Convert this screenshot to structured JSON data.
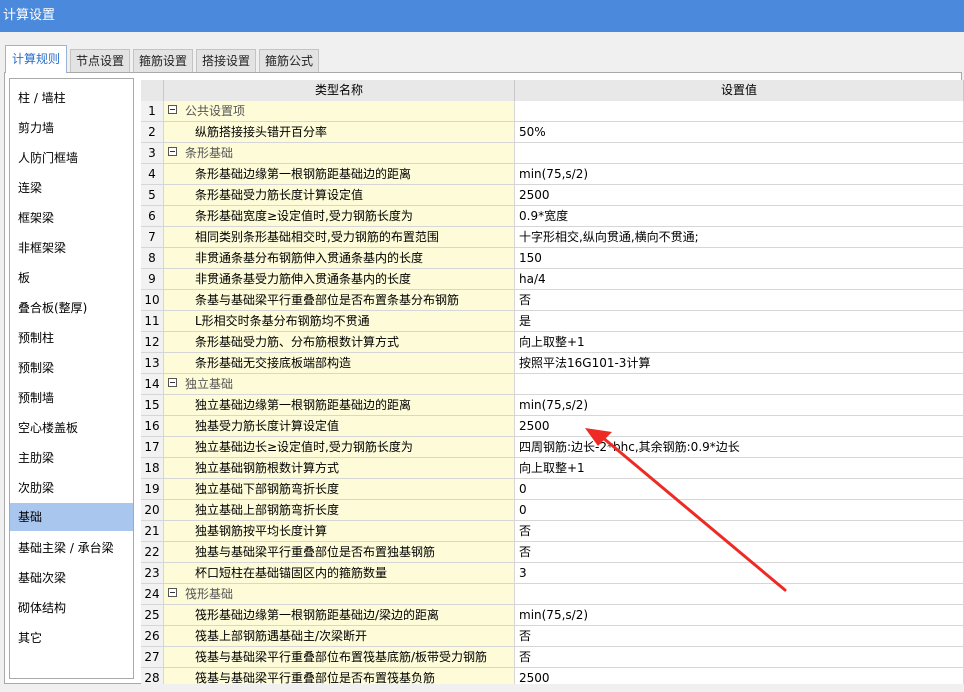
{
  "window": {
    "title": "计算设置"
  },
  "tabs": [
    {
      "label": "计算规则",
      "active": true
    },
    {
      "label": "节点设置",
      "active": false
    },
    {
      "label": "箍筋设置",
      "active": false
    },
    {
      "label": "搭接设置",
      "active": false
    },
    {
      "label": "箍筋公式",
      "active": false
    }
  ],
  "sidebar": {
    "items": [
      {
        "label": "柱 / 墙柱"
      },
      {
        "label": "剪力墙"
      },
      {
        "label": "人防门框墙"
      },
      {
        "label": "连梁"
      },
      {
        "label": "框架梁"
      },
      {
        "label": "非框架梁"
      },
      {
        "label": "板"
      },
      {
        "label": "叠合板(整厚)"
      },
      {
        "label": "预制柱"
      },
      {
        "label": "预制梁"
      },
      {
        "label": "预制墙"
      },
      {
        "label": "空心楼盖板"
      },
      {
        "label": "主肋梁"
      },
      {
        "label": "次肋梁"
      },
      {
        "label": "基础",
        "selected": true
      },
      {
        "label": "基础主梁 / 承台梁"
      },
      {
        "label": "基础次梁"
      },
      {
        "label": "砌体结构"
      },
      {
        "label": "其它"
      }
    ]
  },
  "grid": {
    "columns": {
      "name": "类型名称",
      "value": "设置值"
    },
    "rows": [
      {
        "num": "1",
        "name": "公共设置项",
        "value": "",
        "group": true
      },
      {
        "num": "2",
        "name": "纵筋搭接接头错开百分率",
        "value": "50%"
      },
      {
        "num": "3",
        "name": "条形基础",
        "value": "",
        "group": true
      },
      {
        "num": "4",
        "name": "条形基础边缘第一根钢筋距基础边的距离",
        "value": "min(75,s/2)"
      },
      {
        "num": "5",
        "name": "条形基础受力筋长度计算设定值",
        "value": "2500"
      },
      {
        "num": "6",
        "name": "条形基础宽度≥设定值时,受力钢筋长度为",
        "value": "0.9*宽度"
      },
      {
        "num": "7",
        "name": "相同类别条形基础相交时,受力钢筋的布置范围",
        "value": "十字形相交,纵向贯通,横向不贯通;"
      },
      {
        "num": "8",
        "name": "非贯通条基分布钢筋伸入贯通条基内的长度",
        "value": "150"
      },
      {
        "num": "9",
        "name": "非贯通条基受力筋伸入贯通条基内的长度",
        "value": "ha/4"
      },
      {
        "num": "10",
        "name": "条基与基础梁平行重叠部位是否布置条基分布钢筋",
        "value": "否"
      },
      {
        "num": "11",
        "name": "L形相交时条基分布钢筋均不贯通",
        "value": "是"
      },
      {
        "num": "12",
        "name": "条形基础受力筋、分布筋根数计算方式",
        "value": "向上取整+1"
      },
      {
        "num": "13",
        "name": "条形基础无交接底板端部构造",
        "value": "按照平法16G101-3计算"
      },
      {
        "num": "14",
        "name": "独立基础",
        "value": "",
        "group": true
      },
      {
        "num": "15",
        "name": "独立基础边缘第一根钢筋距基础边的距离",
        "value": "min(75,s/2)"
      },
      {
        "num": "16",
        "name": "独基受力筋长度计算设定值",
        "value": "2500"
      },
      {
        "num": "17",
        "name": "独立基础边长≥设定值时,受力钢筋长度为",
        "value": "四周钢筋:边长-2*bhc,其余钢筋:0.9*边长"
      },
      {
        "num": "18",
        "name": "独立基础钢筋根数计算方式",
        "value": "向上取整+1"
      },
      {
        "num": "19",
        "name": "独立基础下部钢筋弯折长度",
        "value": "0"
      },
      {
        "num": "20",
        "name": "独立基础上部钢筋弯折长度",
        "value": "0"
      },
      {
        "num": "21",
        "name": "独基钢筋按平均长度计算",
        "value": "否"
      },
      {
        "num": "22",
        "name": "独基与基础梁平行重叠部位是否布置独基钢筋",
        "value": "否"
      },
      {
        "num": "23",
        "name": "杯口短柱在基础锚固区内的箍筋数量",
        "value": "3"
      },
      {
        "num": "24",
        "name": "筏形基础",
        "value": "",
        "group": true
      },
      {
        "num": "25",
        "name": "筏形基础边缘第一根钢筋距基础边/梁边的距离",
        "value": "min(75,s/2)"
      },
      {
        "num": "26",
        "name": "筏基上部钢筋遇基础主/次梁断开",
        "value": "否"
      },
      {
        "num": "27",
        "name": "筏基与基础梁平行重叠部位布置筏基底筋/板带受力钢筋",
        "value": "否"
      },
      {
        "num": "28",
        "name": "筏基与基础梁平行重叠部位是否布置筏基负筋",
        "value": "2500"
      }
    ]
  },
  "annotation": {
    "arrow_color": "#ee2a24"
  }
}
